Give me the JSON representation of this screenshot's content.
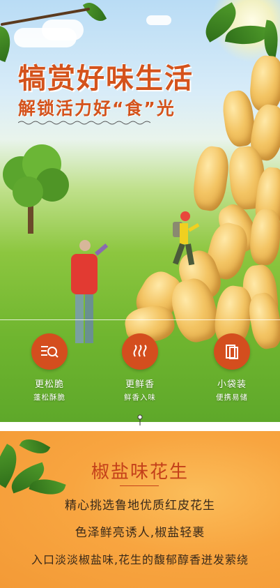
{
  "hero": {
    "title": "犒赏好味生活",
    "subtitle": "解锁活力好“食”光"
  },
  "features": [
    {
      "label": "更松脆",
      "sub": "蓬松酥脆",
      "icon": "search-list-icon"
    },
    {
      "label": "更鲜香",
      "sub": "鲜香入味",
      "icon": "steam-icon"
    },
    {
      "label": "小袋装",
      "sub": "便携易储",
      "icon": "pouch-icon"
    }
  ],
  "product": {
    "title": "椒盐味花生",
    "lines": [
      "精心挑选鲁地优质红皮花生",
      "色泽鲜亮诱人,椒盐轻裹",
      "入口淡淡椒盐味,花生的馥郁醇香迸发萦绕"
    ]
  },
  "colors": {
    "accent": "#d4531c",
    "badge": "#d44e1e",
    "panel": "#f8a540"
  }
}
